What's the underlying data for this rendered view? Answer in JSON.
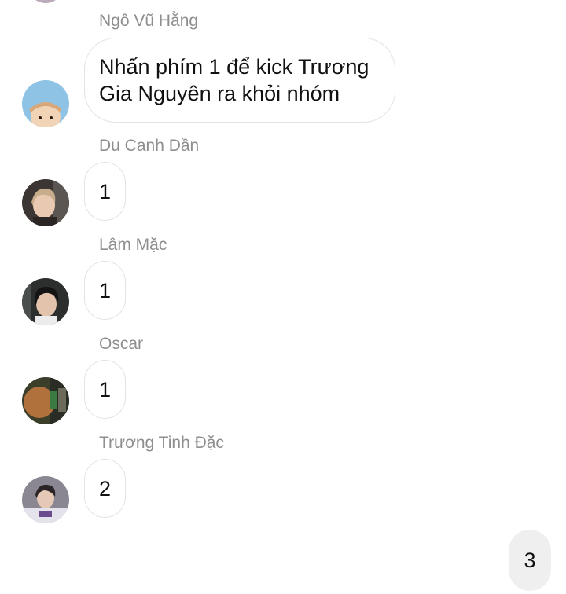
{
  "messages": [
    {
      "sender": "Ngô Vũ Hằng",
      "text": "Nhấn phím 1 để kick Trương Gia Nguyên ra khỏi nhóm",
      "avatar": "avatar-icon"
    },
    {
      "sender": "Du Canh Dần",
      "text": "1",
      "avatar": "avatar-icon"
    },
    {
      "sender": "Lâm Mặc",
      "text": "1",
      "avatar": "avatar-icon"
    },
    {
      "sender": "Oscar",
      "text": "1",
      "avatar": "avatar-icon"
    },
    {
      "sender": "Trương Tinh Đặc",
      "text": "2",
      "avatar": "avatar-icon"
    }
  ],
  "own_message": {
    "text": "3"
  },
  "colors": {
    "sender_name": "#8e8e8e",
    "bubble_border": "#e3e3e3",
    "own_bubble": "#efefef"
  }
}
